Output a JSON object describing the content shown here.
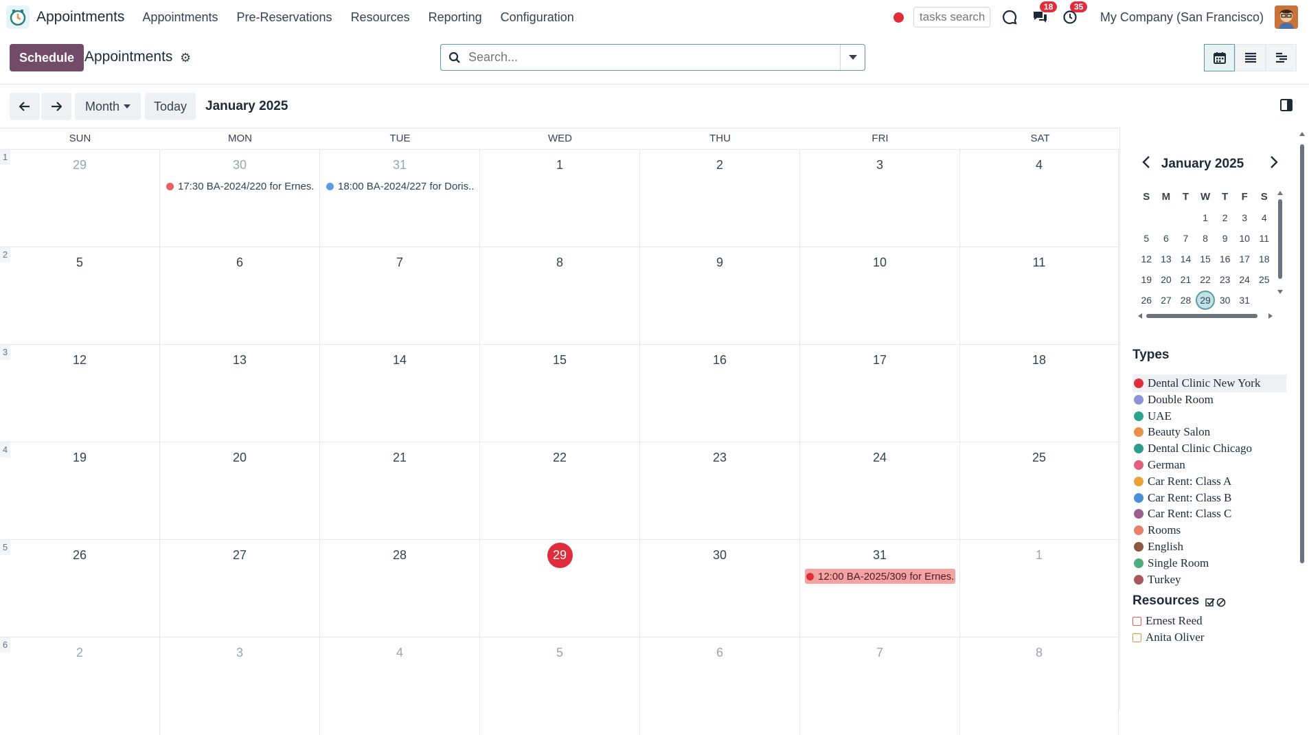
{
  "navbar": {
    "app_name": "Appointments",
    "menu": [
      "Appointments",
      "Pre-Reservations",
      "Resources",
      "Reporting",
      "Configuration"
    ],
    "tasks_search_placeholder": "tasks search",
    "messages_badge": "18",
    "activities_badge": "35",
    "company": "My Company (San Francisco)"
  },
  "control": {
    "schedule_label": "Schedule",
    "title": "Appointments",
    "search_placeholder": "Search..."
  },
  "toolbar": {
    "scale_label": "Month",
    "today_label": "Today",
    "period": "January 2025"
  },
  "calendar": {
    "days_of_week": [
      "SUN",
      "MON",
      "TUE",
      "WED",
      "THU",
      "FRI",
      "SAT"
    ],
    "weeks": [
      {
        "num": "1",
        "days": [
          {
            "n": "29",
            "dim": true
          },
          {
            "n": "30",
            "dim": true,
            "event": {
              "text": "17:30 BA-2024/220 for Ernes...",
              "color": "#e85d5d"
            }
          },
          {
            "n": "31",
            "dim": true,
            "event": {
              "text": "18:00 BA-2024/227 for Doris...",
              "color": "#5b9be8"
            }
          },
          {
            "n": "1"
          },
          {
            "n": "2"
          },
          {
            "n": "3"
          },
          {
            "n": "4"
          }
        ]
      },
      {
        "num": "2",
        "days": [
          {
            "n": "5"
          },
          {
            "n": "6"
          },
          {
            "n": "7"
          },
          {
            "n": "8"
          },
          {
            "n": "9"
          },
          {
            "n": "10"
          },
          {
            "n": "11"
          }
        ]
      },
      {
        "num": "3",
        "days": [
          {
            "n": "12"
          },
          {
            "n": "13"
          },
          {
            "n": "14"
          },
          {
            "n": "15"
          },
          {
            "n": "16"
          },
          {
            "n": "17"
          },
          {
            "n": "18"
          }
        ]
      },
      {
        "num": "4",
        "days": [
          {
            "n": "19"
          },
          {
            "n": "20"
          },
          {
            "n": "21"
          },
          {
            "n": "22"
          },
          {
            "n": "23"
          },
          {
            "n": "24"
          },
          {
            "n": "25"
          }
        ]
      },
      {
        "num": "5",
        "days": [
          {
            "n": "26"
          },
          {
            "n": "27"
          },
          {
            "n": "28"
          },
          {
            "n": "29",
            "today": true
          },
          {
            "n": "30"
          },
          {
            "n": "31",
            "event": {
              "text": "12:00 BA-2025/309 for Ernes...",
              "color": "#e02d3c",
              "highlight": true
            }
          },
          {
            "n": "1",
            "dim": true
          }
        ]
      },
      {
        "num": "6",
        "days": [
          {
            "n": "2",
            "dim": true
          },
          {
            "n": "3",
            "dim": true
          },
          {
            "n": "4",
            "dim": true
          },
          {
            "n": "5",
            "dim": true
          },
          {
            "n": "6",
            "dim": true
          },
          {
            "n": "7",
            "dim": true
          },
          {
            "n": "8",
            "dim": true
          }
        ]
      }
    ]
  },
  "sidebar": {
    "mini_title": "January 2025",
    "mini_headers": [
      "S",
      "M",
      "T",
      "W",
      "T",
      "F",
      "S"
    ],
    "mini_rows": [
      [
        "",
        "",
        "",
        "1",
        "2",
        "3",
        "4"
      ],
      [
        "5",
        "6",
        "7",
        "8",
        "9",
        "10",
        "11"
      ],
      [
        "12",
        "13",
        "14",
        "15",
        "16",
        "17",
        "18"
      ],
      [
        "19",
        "20",
        "21",
        "22",
        "23",
        "24",
        "25"
      ],
      [
        "26",
        "27",
        "28",
        "29",
        "30",
        "31",
        ""
      ]
    ],
    "mini_selected": "29",
    "types_title": "Types",
    "types": [
      {
        "label": "Dental Clinic New York",
        "color": "#e02d3c",
        "active": true
      },
      {
        "label": "Double Room",
        "color": "#8c93d9"
      },
      {
        "label": "UAE",
        "color": "#2aa58e"
      },
      {
        "label": "Beauty Salon",
        "color": "#e8914a"
      },
      {
        "label": "Dental Clinic Chicago",
        "color": "#2a9d8f"
      },
      {
        "label": "German",
        "color": "#e0607e"
      },
      {
        "label": "Car Rent: Class A",
        "color": "#e8a23a"
      },
      {
        "label": "Car Rent: Class B",
        "color": "#4a90d9"
      },
      {
        "label": "Car Rent: Class C",
        "color": "#9b5f8f"
      },
      {
        "label": "Rooms",
        "color": "#e8806a"
      },
      {
        "label": "English",
        "color": "#8b5a3c"
      },
      {
        "label": "Single Room",
        "color": "#4caf7d"
      },
      {
        "label": "Turkey",
        "color": "#a85a5a"
      }
    ],
    "resources_title": "Resources",
    "resources": [
      {
        "label": "Ernest Reed",
        "color": "#e85d5d"
      },
      {
        "label": "Anita Oliver",
        "color": "#e8914a"
      }
    ]
  }
}
